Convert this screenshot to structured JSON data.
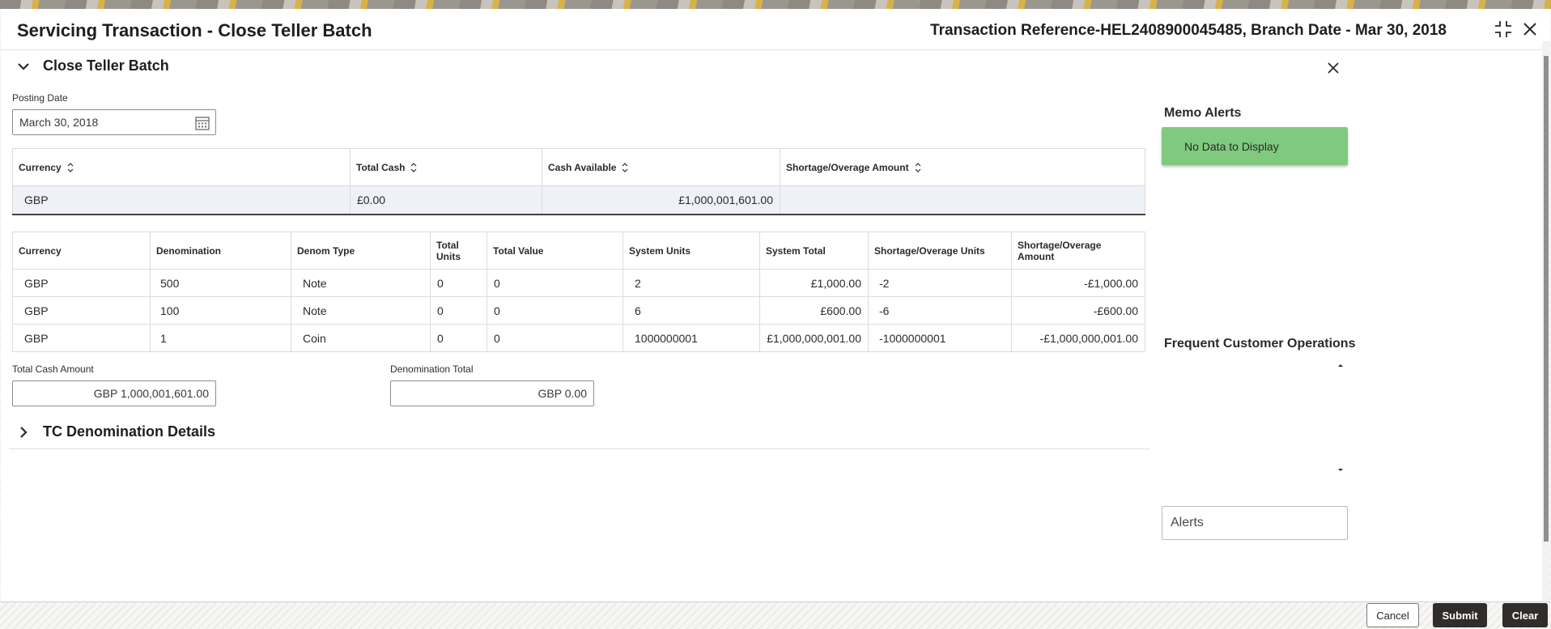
{
  "window": {
    "title": "Servicing Transaction - Close Teller Batch",
    "reference": "Transaction Reference-HEL2408900045485, Branch Date - Mar 30, 2018"
  },
  "section": {
    "title": "Close Teller Batch",
    "posting_date_label": "Posting Date",
    "posting_date_value": "March 30, 2018"
  },
  "summary_table": {
    "headers": [
      "Currency",
      "Total Cash",
      "Cash Available",
      "Shortage/Overage Amount"
    ],
    "row": [
      "GBP",
      "£0.00",
      "£1,000,001,601.00",
      ""
    ]
  },
  "denom_table": {
    "headers": [
      "Currency",
      "Denomination",
      "Denom Type",
      "Total Units",
      "Total Value",
      "System Units",
      "System Total",
      "Shortage/Overage Units",
      "Shortage/Overage Amount"
    ],
    "rows": [
      [
        "GBP",
        "500",
        "Note",
        "0",
        "0",
        "2",
        "£1,000.00",
        "-2",
        "-£1,000.00"
      ],
      [
        "GBP",
        "100",
        "Note",
        "0",
        "0",
        "6",
        "£600.00",
        "-6",
        "-£600.00"
      ],
      [
        "GBP",
        "1",
        "Coin",
        "0",
        "0",
        "1000000001",
        "£1,000,000,001.00",
        "-1000000001",
        "-£1,000,000,001.00"
      ]
    ]
  },
  "totals": {
    "total_cash_label": "Total Cash Amount",
    "total_cash_value": "GBP 1,000,001,601.00",
    "denom_total_label": "Denomination Total",
    "denom_total_value": "GBP 0.00"
  },
  "tc_section": {
    "title": "TC Denomination Details"
  },
  "side_panel": {
    "memo_title": "Memo Alerts",
    "memo_empty": "No Data to Display",
    "frequent_title": "Frequent Customer Operations",
    "alerts_label": "Alerts"
  },
  "buttons": {
    "cancel": "Cancel",
    "submit": "Submit",
    "clear": "Clear"
  },
  "icons": {
    "calendar": "calendar-icon",
    "collapse_expand": "minimize-icon",
    "close": "close-icon",
    "sort": "sort-icon",
    "chevron_down": "chevron-down-icon",
    "chevron_right": "chevron-right-icon"
  },
  "colors": {
    "memo_bg": "#7fca7e",
    "primary_button": "#312d2a",
    "selected_row": "#eef1f7"
  }
}
